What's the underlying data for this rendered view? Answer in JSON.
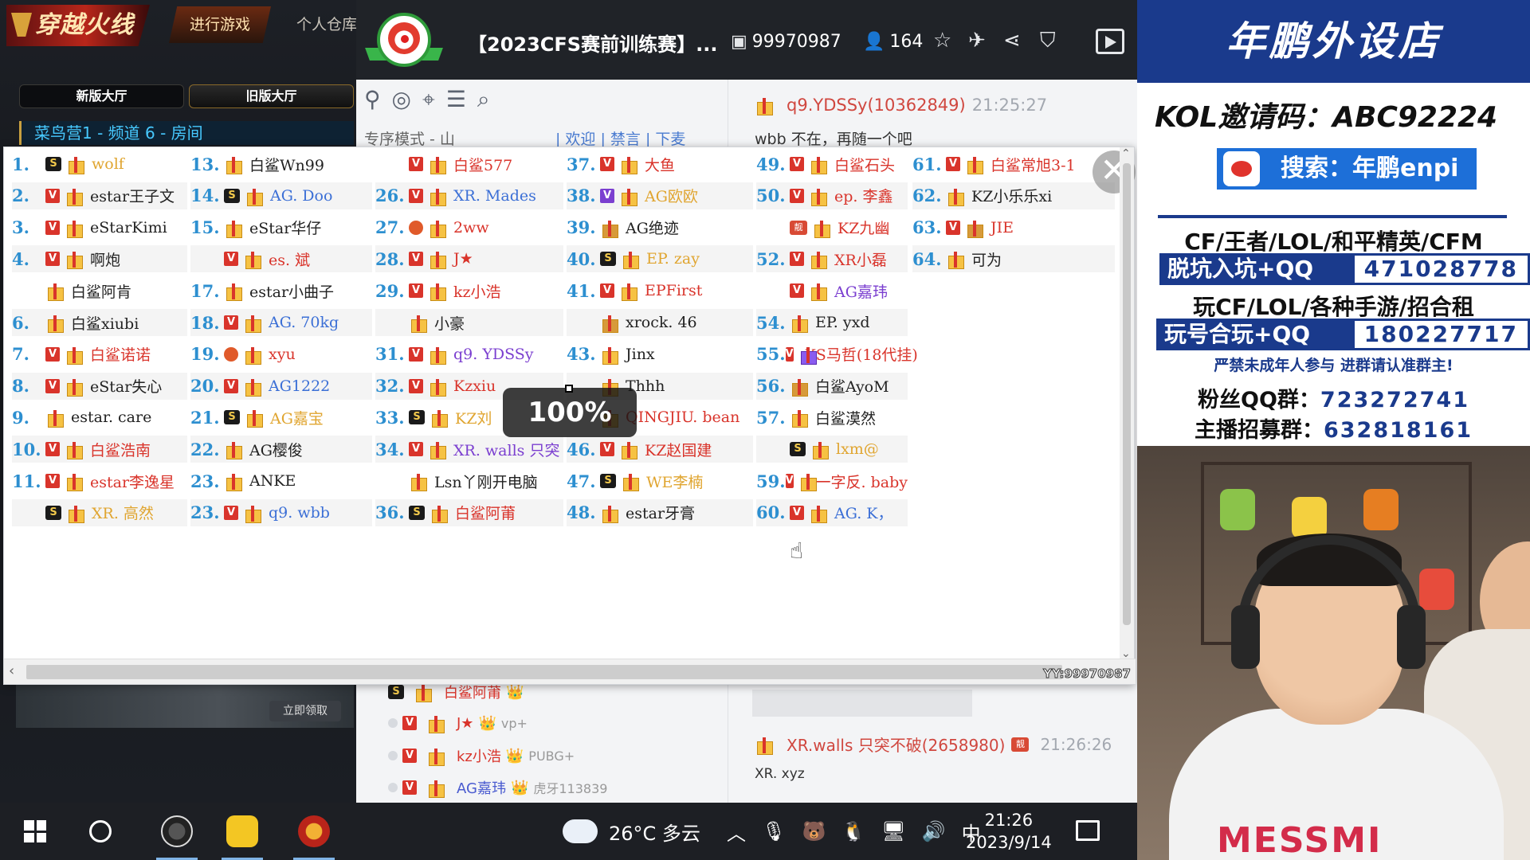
{
  "game": {
    "logo_text": "穿越火线",
    "tabs": [
      "进行游戏",
      "个人仓库"
    ],
    "hall_tabs": [
      "新版大厅",
      "旧版大厅"
    ],
    "room_strip": "菜鸟营1 - 频道 6 - 房间",
    "promo_button": "立即领取"
  },
  "room": {
    "title": "【2023CFS赛前训练赛】...",
    "id": "99970987",
    "viewers": "164",
    "under_row": "专序模式 - 山",
    "under_row_links": "| 欢迎 | 禁言 | 下麦",
    "first_chat": {
      "user": "q9.YDSSy(10362849)",
      "time": "21:25:27"
    },
    "first_chat_text": "wbb 不在，再随一个吧",
    "fan_rows": [
      {
        "name": "白鲨阿莆",
        "extra": ""
      },
      {
        "name": "J★",
        "extra": "vp+"
      },
      {
        "name": "kz小浩",
        "extra": "PUBG+"
      },
      {
        "name": "AG嘉玮",
        "extra": "虎牙113839"
      }
    ],
    "chat": {
      "user": "XR.walls 只突不破(2658980)",
      "time": "21:26:26",
      "text": "XR. xyz"
    }
  },
  "popup": {
    "zoom": "100%",
    "watermark": "YY:99970987",
    "columns": [
      [
        {
          "num": "1.",
          "badge": "s",
          "gift": "gold",
          "name": "wolf",
          "color": "gold"
        },
        {
          "num": "2.",
          "badge": "v",
          "gift": "gold",
          "name": "estar王子文",
          "color": "dark"
        },
        {
          "num": "3.",
          "badge": "v",
          "gift": "gold",
          "name": "eStarKimi",
          "color": "dark"
        },
        {
          "num": "4.",
          "badge": "v",
          "gift": "gold",
          "name": "啊炮",
          "color": "dark"
        },
        {
          "num": "",
          "badge": "",
          "gift": "gold",
          "name": "白鲨阿肯",
          "color": "dark"
        },
        {
          "num": "6.",
          "badge": "",
          "gift": "gold",
          "name": "白鲨xiubi",
          "color": "dark"
        },
        {
          "num": "7.",
          "badge": "v",
          "gift": "gold",
          "name": "白鲨诺诺",
          "color": "red"
        },
        {
          "num": "8.",
          "badge": "v",
          "gift": "gold",
          "name": "eStar失心",
          "color": "dark"
        },
        {
          "num": "9.",
          "badge": "",
          "gift": "gold",
          "name": "estar. care",
          "color": "dark"
        },
        {
          "num": "10.",
          "badge": "v",
          "gift": "gold",
          "name": "白鲨浩南",
          "color": "red"
        },
        {
          "num": "11.",
          "badge": "v",
          "gift": "gold",
          "name": "estar李逸星",
          "color": "red"
        },
        {
          "num": "",
          "badge": "s",
          "gift": "gold",
          "name": "XR. 高然",
          "color": "gold"
        }
      ],
      [
        {
          "num": "13.",
          "badge": "",
          "gift": "gold",
          "name": "白鲨Wn99",
          "color": "dark"
        },
        {
          "num": "14.",
          "badge": "s",
          "gift": "gold",
          "name": "AG. Doo",
          "color": "blue"
        },
        {
          "num": "15.",
          "badge": "",
          "gift": "gold",
          "name": "eStar华仔",
          "color": "dark"
        },
        {
          "num": "",
          "badge": "v",
          "gift": "gold",
          "name": "es. 斌",
          "color": "red"
        },
        {
          "num": "17.",
          "badge": "",
          "gift": "gold",
          "name": "estar小曲子",
          "color": "dark"
        },
        {
          "num": "18.",
          "badge": "v",
          "gift": "gold",
          "name": "AG. 70kg",
          "color": "blue"
        },
        {
          "num": "19.",
          "badge": "r",
          "gift": "gold",
          "name": "xyu",
          "color": "red"
        },
        {
          "num": "20.",
          "badge": "v",
          "gift": "gold",
          "name": "AG1222",
          "color": "blue"
        },
        {
          "num": "21.",
          "badge": "s",
          "gift": "gold",
          "name": "AG嘉宝",
          "color": "gold"
        },
        {
          "num": "22.",
          "badge": "",
          "gift": "gold",
          "name": "AG樱俊",
          "color": "dark"
        },
        {
          "num": "23.",
          "badge": "",
          "gift": "gold",
          "name": "ANKE",
          "color": "dark"
        },
        {
          "num": "23.",
          "badge": "v",
          "gift": "gold",
          "name": "q9. wbb",
          "color": "blue"
        }
      ],
      [
        {
          "num": "",
          "badge": "v",
          "gift": "gold",
          "name": "白鲨577",
          "color": "red"
        },
        {
          "num": "26.",
          "badge": "v",
          "gift": "gold",
          "name": "XR. Mades",
          "color": "blue"
        },
        {
          "num": "27.",
          "badge": "r",
          "gift": "gold",
          "name": "2ww",
          "color": "red"
        },
        {
          "num": "28.",
          "badge": "v",
          "gift": "gold",
          "name": "J★",
          "color": "red"
        },
        {
          "num": "29.",
          "badge": "v",
          "gift": "gold",
          "name": "kz小浩",
          "color": "red"
        },
        {
          "num": "",
          "badge": "",
          "gift": "gold",
          "name": "小豪",
          "color": "dark"
        },
        {
          "num": "31.",
          "badge": "v",
          "gift": "gold",
          "name": "q9. YDSSy",
          "color": "purple"
        },
        {
          "num": "32.",
          "badge": "v",
          "gift": "gold",
          "name": "Kzxiu",
          "color": "red"
        },
        {
          "num": "33.",
          "badge": "s",
          "gift": "gold",
          "name": "KZ刘",
          "color": "gold"
        },
        {
          "num": "34.",
          "badge": "v",
          "gift": "gold",
          "name": "XR. walls 只突",
          "color": "purple"
        },
        {
          "num": "",
          "badge": "",
          "gift": "gold",
          "name": "Lsn丫刚开电脑",
          "color": "dark"
        },
        {
          "num": "36.",
          "badge": "s",
          "gift": "gold",
          "name": "白鲨阿莆",
          "color": "red"
        }
      ],
      [
        {
          "num": "37.",
          "badge": "v",
          "gift": "gold",
          "name": "大鱼",
          "color": "red"
        },
        {
          "num": "38.",
          "badge": "vp",
          "gift": "gold",
          "name": "AG欧欧",
          "color": "gold"
        },
        {
          "num": "39.",
          "badge": "",
          "gift": "dark",
          "name": "AG绝迹",
          "color": "dark"
        },
        {
          "num": "40.",
          "badge": "s",
          "gift": "gold",
          "name": "EP. zay",
          "color": "gold"
        },
        {
          "num": "41.",
          "badge": "v",
          "gift": "gold",
          "name": "EPFirst",
          "color": "red"
        },
        {
          "num": "",
          "badge": "",
          "gift": "dark",
          "name": "xrock. 46",
          "color": "dark"
        },
        {
          "num": "43.",
          "badge": "",
          "gift": "gold",
          "name": "Jinx",
          "color": "dark"
        },
        {
          "num": "",
          "badge": "",
          "gift": "gold",
          "name": "Thhh",
          "color": "dark"
        },
        {
          "num": "",
          "badge": "",
          "gift": "gold",
          "name": "QINGJIU. bean",
          "color": "red"
        },
        {
          "num": "46.",
          "badge": "v",
          "gift": "gold",
          "name": "KZ赵国建",
          "color": "red"
        },
        {
          "num": "47.",
          "badge": "s",
          "gift": "gold",
          "name": "WE李楠",
          "color": "gold"
        },
        {
          "num": "48.",
          "badge": "",
          "gift": "gold",
          "name": "estar牙膏",
          "color": "dark"
        }
      ],
      [
        {
          "num": "49.",
          "badge": "v",
          "gift": "gold",
          "name": "白鲨石头",
          "color": "red"
        },
        {
          "num": "50.",
          "badge": "v",
          "gift": "gold",
          "name": "ep. 李鑫",
          "color": "red"
        },
        {
          "num": "",
          "badge": "c",
          "gift": "gold",
          "name": "KZ九幽",
          "color": "red"
        },
        {
          "num": "52.",
          "badge": "v",
          "gift": "gold",
          "name": "XR小磊",
          "color": "red"
        },
        {
          "num": "",
          "badge": "v",
          "gift": "gold",
          "name": "AG嘉玮",
          "color": "purple"
        },
        {
          "num": "54.",
          "badge": "",
          "gift": "gold",
          "name": "EP. yxd",
          "color": "dark"
        },
        {
          "num": "55.",
          "badge": "v",
          "gift": "purple",
          "name": "KS马哲(18代挂)",
          "color": "red"
        },
        {
          "num": "56.",
          "badge": "",
          "gift": "dark",
          "name": "白鲨AyoM",
          "color": "dark"
        },
        {
          "num": "57.",
          "badge": "",
          "gift": "gold",
          "name": "白鲨漠然",
          "color": "dark"
        },
        {
          "num": "",
          "badge": "s",
          "gift": "gold",
          "name": "lxm@",
          "color": "gold"
        },
        {
          "num": "59.",
          "badge": "v",
          "gift": "gold",
          "name": "一字反. baby",
          "color": "red"
        },
        {
          "num": "60.",
          "badge": "v",
          "gift": "gold",
          "name": "AG. K，",
          "color": "blue"
        }
      ],
      [
        {
          "num": "61.",
          "badge": "v",
          "gift": "gold",
          "name": "白鲨常旭3-1",
          "color": "red"
        },
        {
          "num": "62.",
          "badge": "",
          "gift": "gold",
          "name": "KZ小乐乐xi",
          "color": "dark"
        },
        {
          "num": "63.",
          "badge": "v",
          "gift": "dark",
          "name": "JIE",
          "color": "red"
        },
        {
          "num": "64.",
          "badge": "",
          "gift": "gold",
          "name": "可为",
          "color": "dark"
        }
      ]
    ]
  },
  "shop": {
    "title": "年鹏外设店",
    "kol": "KOL邀请码：ABC92224",
    "weibo": "搜索：年鹏enpi",
    "games": "CF/王者/LOL/和平精英/CFM",
    "qq1_label": "脱坑入坑+QQ群：",
    "qq1_value": "471028778",
    "line2": "玩CF/LOL/各种手游/招合租",
    "qq2_label": "玩号合玩+QQ群：",
    "qq2_value": "180227717",
    "warn": "严禁未成年人参与  进群请认准群主!",
    "fans_label": "粉丝QQ群：",
    "fans_value": "723272741",
    "anchor_label": "主播招募群：",
    "anchor_value": "632818161"
  },
  "webcam": {
    "shirt_text": "MESSMI"
  },
  "taskbar": {
    "weather": "26°C  多云",
    "ime": "中",
    "time": "21:26",
    "date": "2023/9/14"
  },
  "colors": {
    "accent_blue": "#1a3a8c",
    "number_blue": "#2d8fd0",
    "vip_red": "#d9342b",
    "taskbar": "#1d1f24"
  }
}
